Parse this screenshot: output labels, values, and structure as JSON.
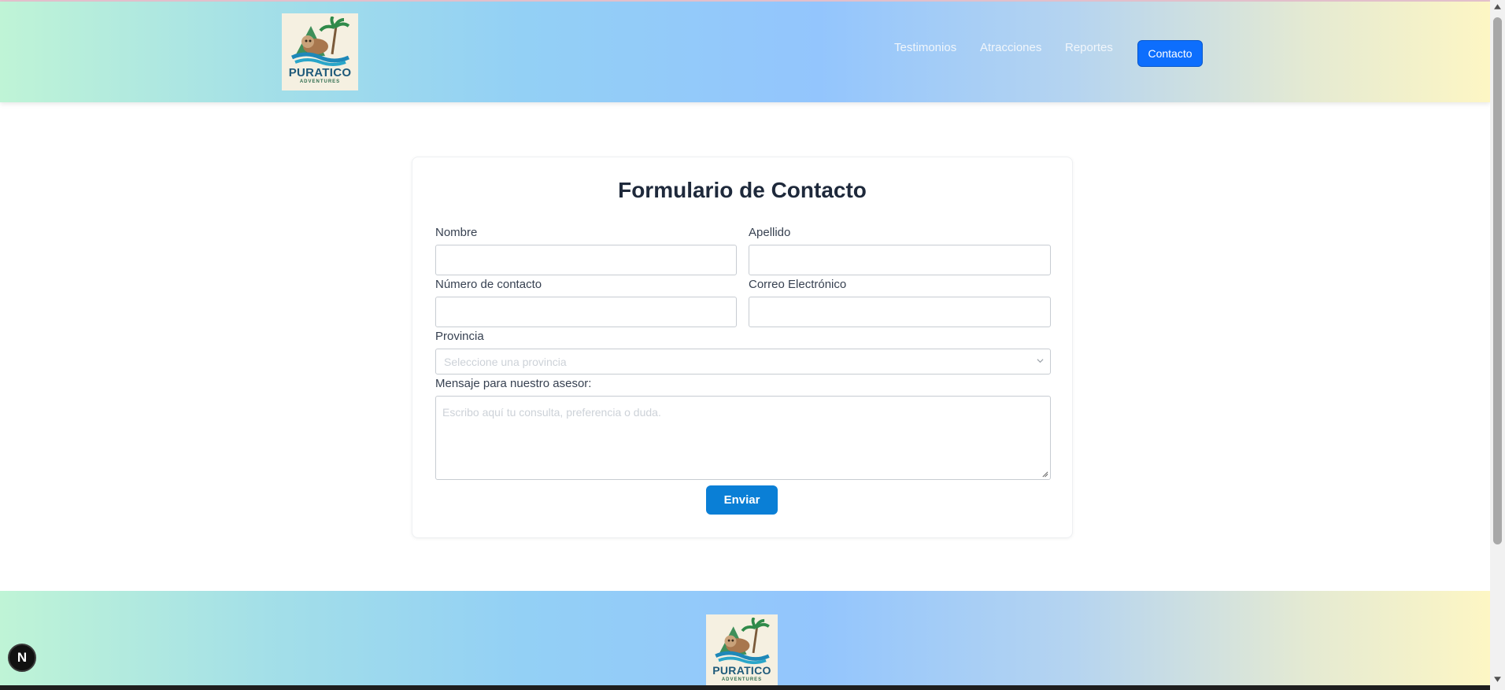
{
  "brand": {
    "name": "PURATICO",
    "tagline": "ADVENTURES"
  },
  "nav": {
    "items": [
      "Testimonios",
      "Atracciones",
      "Reportes"
    ],
    "contact_button": "Contacto"
  },
  "form": {
    "title": "Formulario de Contacto",
    "first_name_label": "Nombre",
    "first_name_value": "",
    "last_name_label": "Apellido",
    "last_name_value": "",
    "phone_label": "Número de contacto",
    "phone_value": "",
    "email_label": "Correo Electrónico",
    "email_value": "",
    "province_label": "Provincia",
    "province_placeholder": "Seleccione una provincia",
    "message_label": "Mensaje para nuestro asesor:",
    "message_placeholder": "Escribo aquí tu consulta, preferencia o duda.",
    "submit_label": "Enviar"
  },
  "dev_badge": {
    "letter": "N"
  },
  "colors": {
    "primary_button": "#0d6efd",
    "submit_button": "#0a7fd6",
    "gradient_start": "#bff4d6",
    "gradient_mid": "#93c5fd",
    "gradient_end": "#fdf6c4"
  }
}
